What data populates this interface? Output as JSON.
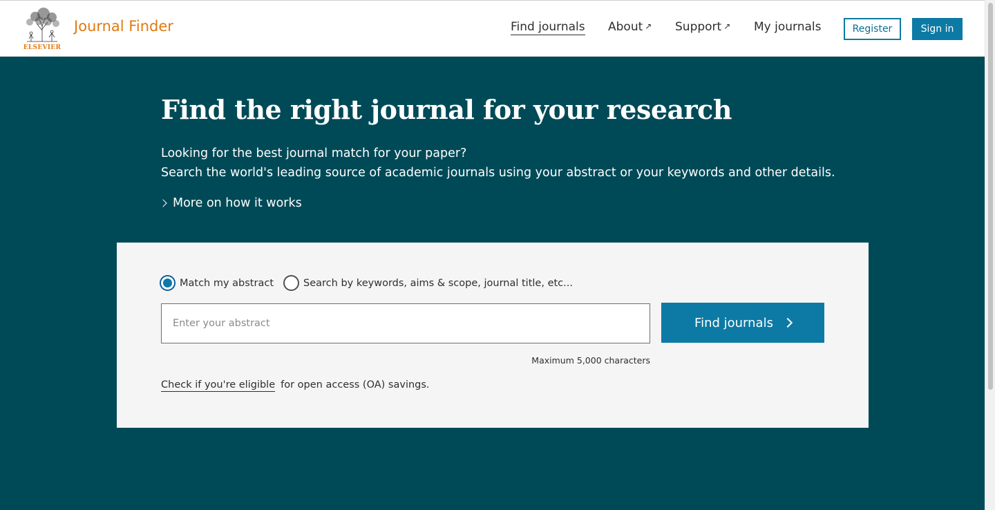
{
  "header": {
    "brand": "Journal Finder",
    "publisher": "ELSEVIER",
    "nav": [
      {
        "label": "Find journals",
        "external": false
      },
      {
        "label": "About",
        "external": true
      },
      {
        "label": "Support",
        "external": true
      },
      {
        "label": "My journals",
        "external": false
      }
    ],
    "external_glyph": "↗",
    "register_label": "Register",
    "signin_label": "Sign in"
  },
  "hero": {
    "title": "Find the right journal for your research",
    "subtitle_line1": "Looking for the best journal match for your paper?",
    "subtitle_line2": "Search the world's leading source of academic journals using your abstract or your keywords and other details.",
    "more_link": "More on how it works"
  },
  "search": {
    "radio_options": [
      {
        "label": "Match my abstract",
        "checked": true
      },
      {
        "label": "Search by keywords, aims & scope, journal title, etc...",
        "checked": false
      }
    ],
    "input_placeholder": "Enter your abstract",
    "input_value": "",
    "find_button": "Find journals",
    "max_chars": "Maximum 5,000 characters",
    "oa_link": "Check if you're eligible",
    "oa_text": "for open access (OA) savings."
  },
  "colors": {
    "brand_orange": "#e07a10",
    "hero_bg": "#004a57",
    "accent_blue": "#0c7aa4",
    "card_bg": "#f5f5f5"
  }
}
